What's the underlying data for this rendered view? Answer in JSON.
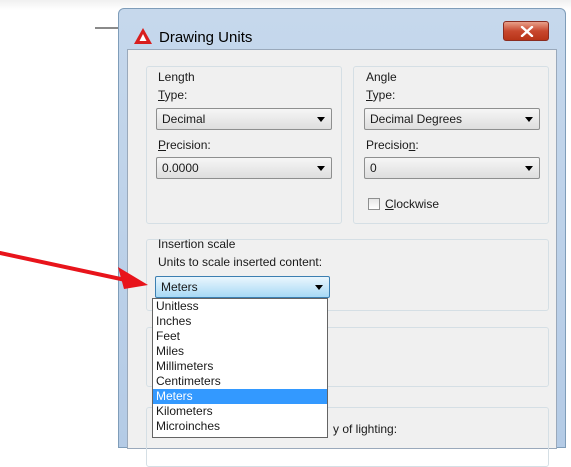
{
  "dialog": {
    "title": "Drawing Units"
  },
  "length": {
    "group_label": "Length",
    "type_label": "Type:",
    "type_value": "Decimal",
    "precision_label": "Precision:",
    "precision_value": "0.0000"
  },
  "angle": {
    "group_label": "Angle",
    "type_label": "Type:",
    "type_value": "Decimal Degrees",
    "precision_label": "Precision:",
    "precision_value": "0",
    "clockwise_label": "Clockwise",
    "clockwise_checked": false
  },
  "insertion": {
    "group_label": "Insertion scale",
    "units_label": "Units to scale inserted content:",
    "selected_value": "Meters",
    "options": [
      "Unitless",
      "Inches",
      "Feet",
      "Miles",
      "Millimeters",
      "Centimeters",
      "Meters",
      "Kilometers",
      "Microinches"
    ],
    "highlighted_index": 6
  },
  "lighting": {
    "partial_label": "y of lighting:"
  },
  "annotation": {
    "arrow_color": "#e8141b"
  },
  "icons": {
    "app_logo": "autocad-logo-icon",
    "close": "close-icon",
    "dropdown": "chevron-down-icon",
    "annotation": "red-arrow-icon"
  }
}
